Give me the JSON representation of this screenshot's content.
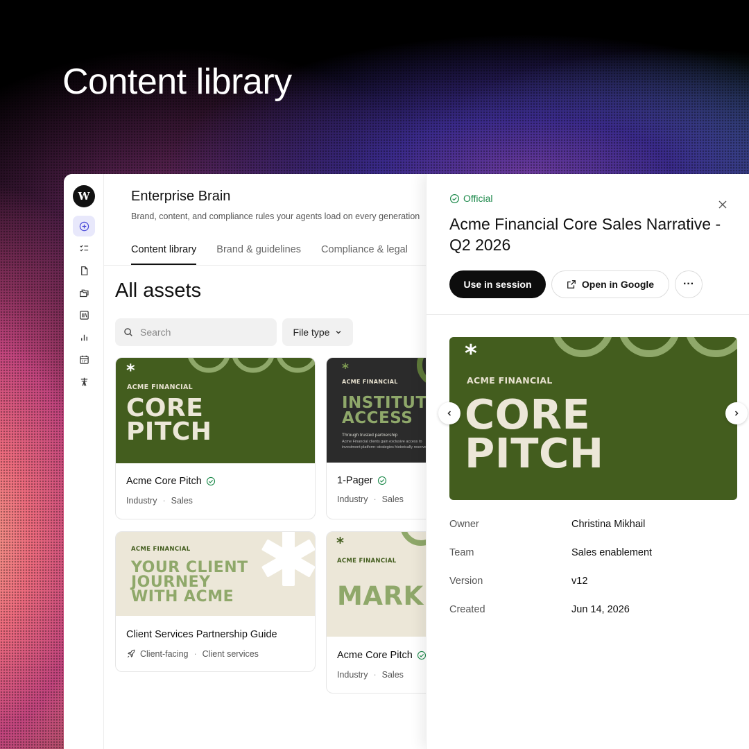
{
  "hero": {
    "title": "Content library"
  },
  "rail": {
    "logo": "W",
    "items": [
      "plus-circle-icon",
      "checklist-icon",
      "document-icon",
      "folders-icon",
      "library-icon",
      "bar-chart-icon",
      "calendar-icon",
      "tower-icon"
    ]
  },
  "main": {
    "title": "Enterprise Brain",
    "subtitle": "Brand, content, and compliance rules your agents load on every generation",
    "tabs": [
      {
        "label": "Content library"
      },
      {
        "label": "Brand & guidelines"
      },
      {
        "label": "Compliance & legal"
      }
    ],
    "section_title": "All assets",
    "search_placeholder": "Search",
    "filter_label": "File type",
    "cards": [
      {
        "title": "Acme Core Pitch",
        "meta": [
          "Industry",
          "Sales"
        ],
        "thumb_brand": "ACME FINANCIAL",
        "thumb_lines": [
          "CORE",
          "PITCH"
        ]
      },
      {
        "title": "1-Pager",
        "meta": [
          "Industry",
          "Sales"
        ],
        "thumb_brand": "ACME FINANCIAL",
        "thumb_lines": [
          "INSTITUTIONAL",
          "ACCESS"
        ],
        "thumb_caption": "Through trusted partnership",
        "thumb_body": [
          "Acme Financial clients gain exclusive access to",
          "investment platform–strategies historically reserved"
        ]
      },
      {
        "title": "Client Services Partnership Guide",
        "meta": [
          "Client-facing",
          "Client services"
        ],
        "thumb_brand": "ACME FINANCIAL",
        "thumb_lines": [
          "YOUR CLIENT",
          "JOURNEY",
          "WITH ACME"
        ]
      },
      {
        "title": "Acme Core Pitch",
        "meta": [
          "Industry",
          "Sales"
        ],
        "thumb_brand": "ACME FINANCIAL",
        "thumb_lines": [
          "MARKET"
        ]
      }
    ]
  },
  "panel": {
    "badge": "Official",
    "title": "Acme Financial Core Sales Narrative - Q2 2026",
    "primary_button": "Use in session",
    "secondary_button": "Open in Google",
    "more_button": "···",
    "preview": {
      "brand": "ACME FINANCIAL",
      "lines": [
        "CORE",
        "PITCH"
      ]
    },
    "details": [
      {
        "label": "Owner",
        "value": "Christina Mikhail"
      },
      {
        "label": "Team",
        "value": "Sales enablement"
      },
      {
        "label": "Version",
        "value": "v12"
      },
      {
        "label": "Created",
        "value": "Jun 14, 2026"
      }
    ]
  },
  "colors": {
    "dark_green": "#435d1e",
    "light_green": "#8fa86a",
    "cream": "#ece7d8",
    "charcoal": "#2b2b2b",
    "official_green": "#1e8a4c",
    "active_rail": "#e8e8fb",
    "rail_icon_active": "#4a4ad8"
  }
}
